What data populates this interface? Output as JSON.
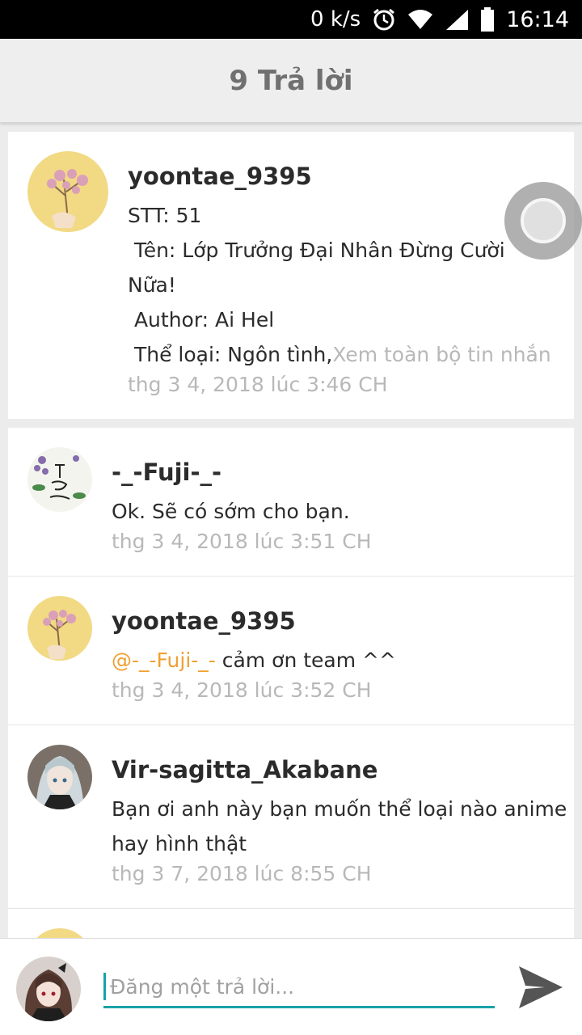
{
  "status_bar": {
    "network_speed": "0 k/s",
    "time": "16:14",
    "icons": [
      "alarm-icon",
      "wifi-icon",
      "signal-icon",
      "battery-icon"
    ]
  },
  "header": {
    "title": "9 Trả lời"
  },
  "op": {
    "username": "yoontae_9395",
    "lines": [
      "STT: 51",
      " Tên: Lớp Trưởng Đại Nhân Đừng Cười",
      "Nữa!",
      " Author: Ai Hel",
      " Thể loại: Ngôn tình,"
    ],
    "more_link": "Xem toàn bộ tin nhắn",
    "timestamp": "thg 3 4, 2018 lúc 3:46 CH"
  },
  "replies": [
    {
      "username": "-_-Fuji-_-",
      "text": "Ok. Sẽ có sớm cho bạn.",
      "timestamp": "thg 3 4, 2018 lúc 3:51 CH"
    },
    {
      "username": "yoontae_9395",
      "mention": "@-_-Fuji-_-",
      "text": " cảm ơn team ^^",
      "timestamp": "thg 3 4, 2018 lúc 3:52 CH"
    },
    {
      "username": "Vir-sagitta_Akabane",
      "lines": [
        "Bạn ơi anh này bạn muốn thể loại nào anime",
        "hay hình thật"
      ],
      "timestamp": "thg 3 7, 2018 lúc 8:55 CH"
    }
  ],
  "composer": {
    "placeholder": "Đăng một trả lời..."
  },
  "colors": {
    "accent": "#1aa2a8",
    "mention": "#f0a030",
    "meta": "#b8b8b8"
  }
}
